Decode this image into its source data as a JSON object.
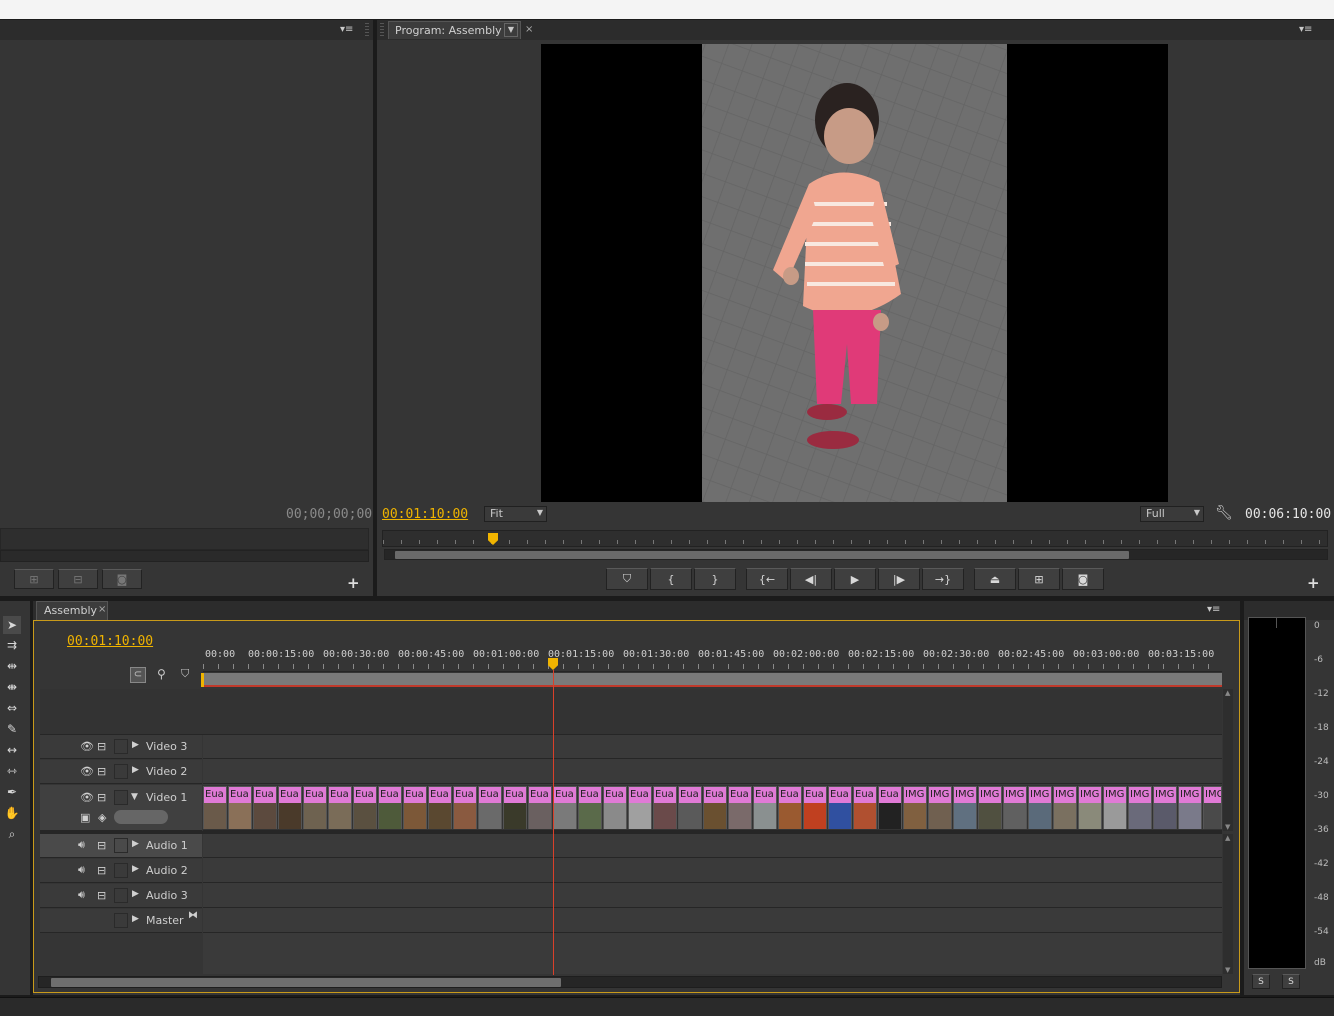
{
  "source_panel": {
    "timecode": "00;00;00;00"
  },
  "program": {
    "tab_label": "Program: Assembly",
    "timecode_current": "00:01:10:00",
    "zoom": "Fit",
    "quality": "Full",
    "duration": "00:06:10:00"
  },
  "timeline": {
    "tab_label": "Assembly",
    "timecode": "00:01:10:00",
    "ruler": [
      "00:00",
      "00:00:15:00",
      "00:00:30:00",
      "00:00:45:00",
      "00:01:00:00",
      "00:01:15:00",
      "00:01:30:00",
      "00:01:45:00",
      "00:02:00:00",
      "00:02:15:00",
      "00:02:30:00",
      "00:02:45:00",
      "00:03:00:00",
      "00:03:15:00"
    ],
    "tracks": {
      "video3": "Video 3",
      "video2": "Video 2",
      "video1": "Video 1",
      "audio1": "Audio 1",
      "audio2": "Audio 2",
      "audio3": "Audio 3",
      "master": "Master"
    },
    "clips": [
      "Eua",
      "Eua",
      "Eua",
      "Eua",
      "Eua",
      "Eua",
      "Eua",
      "Eua",
      "Eua",
      "Eua",
      "Eua",
      "Eua",
      "Eua",
      "Eua",
      "Eua",
      "Eua",
      "Eua",
      "Eua",
      "Eua",
      "Eua",
      "Eua",
      "Eua",
      "Eua",
      "Eua",
      "Eua",
      "Eua",
      "Eua",
      "Eua",
      "IMG",
      "IMG",
      "IMG",
      "IMG",
      "IMG",
      "IMG",
      "IMG",
      "IMG",
      "IMG",
      "IMG",
      "IMG",
      "IMG",
      "IMG"
    ],
    "clip_colors": [
      "#6a5a4a",
      "#8a7058",
      "#5c4a3e",
      "#4a3a2a",
      "#6e6250",
      "#7a6c58",
      "#5a5040",
      "#4e5a3a",
      "#7c5838",
      "#5a4830",
      "#8a5a40",
      "#6a6a6a",
      "#3a3a2a",
      "#6a6060",
      "#7a7a7a",
      "#5a6a4a",
      "#8a8a8a",
      "#a0a0a0",
      "#6a4a4a",
      "#5a5a5a",
      "#6a5030",
      "#7a6a6a",
      "#8a9090",
      "#9a5a30",
      "#c04020",
      "#3050a0",
      "#b05030",
      "#222222",
      "#806040",
      "#706050",
      "#607080",
      "#505040",
      "#606060",
      "#5a6a7a",
      "#7a7060",
      "#8a8a7a",
      "#9a9a9a",
      "#6a6a7a",
      "#5a5a6a",
      "#7a7a8a",
      "#4a4a4a"
    ],
    "meter_labels": [
      "0",
      "-6",
      "-12",
      "-18",
      "-24",
      "-30",
      "-36",
      "-42",
      "-48",
      "-54",
      "dB"
    ],
    "meter_buttons": [
      "S",
      "S"
    ]
  }
}
